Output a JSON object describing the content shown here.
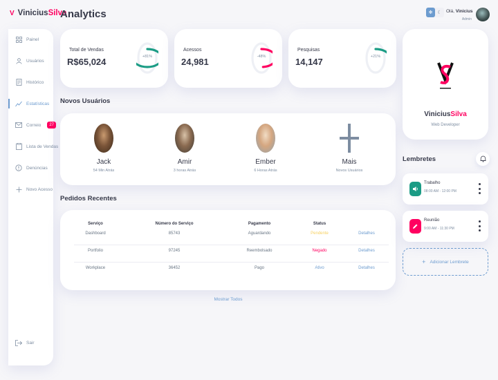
{
  "brand": {
    "first": "Vinicius",
    "second": "Silva"
  },
  "page": {
    "title": "Analytics"
  },
  "sidebar": {
    "items": [
      {
        "label": "Painel",
        "icon": "grid-icon"
      },
      {
        "label": "Usuários",
        "icon": "user-icon"
      },
      {
        "label": "Histórico",
        "icon": "receipt-icon"
      },
      {
        "label": "Estatísticas",
        "icon": "chart-line-icon",
        "active": true
      },
      {
        "label": "Correio",
        "icon": "mail-icon",
        "badge": "27"
      },
      {
        "label": "Lista de Vendas",
        "icon": "inventory-icon"
      },
      {
        "label": "Denúncias",
        "icon": "report-icon"
      },
      {
        "label": "Novo Acesso",
        "icon": "plus-icon"
      }
    ],
    "logout": "Sair"
  },
  "header": {
    "greeting_prefix": "Olá,",
    "user_name": "Vinicius",
    "role": "Admin"
  },
  "stats": [
    {
      "label": "Total de Vendas",
      "value": "R$65,024",
      "percent": "+81%",
      "fraction": 0.81,
      "color": "#1b9c85"
    },
    {
      "label": "Acessos",
      "value": "24,981",
      "percent": "-48%",
      "fraction": 0.48,
      "color": "#ff0060"
    },
    {
      "label": "Pesquisas",
      "value": "14,147",
      "percent": "+21%",
      "fraction": 0.21,
      "color": "#1b9c85"
    }
  ],
  "new_users": {
    "title": "Novos Usuários",
    "users": [
      {
        "name": "Jack",
        "time": "54 Min Atrás"
      },
      {
        "name": "Amir",
        "time": "3 horas Atrás"
      },
      {
        "name": "Ember",
        "time": "6 Horas Atrás"
      },
      {
        "name": "Mais",
        "time": "Novos Usuários"
      }
    ]
  },
  "orders": {
    "title": "Pedidos Recentes",
    "columns": [
      "Serviço",
      "Número do Serviço",
      "Pagamento",
      "Status",
      ""
    ],
    "rows": [
      {
        "service": "Dashboard",
        "number": "85743",
        "payment": "Aguardando",
        "status": "Pendente",
        "status_color": "#f7d060",
        "action": "Detalhes"
      },
      {
        "service": "Portfolio",
        "number": "97245",
        "payment": "Reembolsado",
        "status": "Negado",
        "status_color": "#ff0060",
        "action": "Detalhes"
      },
      {
        "service": "Workplace",
        "number": "36452",
        "payment": "Pago",
        "status": "Ativo",
        "status_color": "#6c9bcf",
        "action": "Detalhes"
      }
    ],
    "show_all": "Mostrar Todos"
  },
  "profile": {
    "name_first": "Vinicius",
    "name_second": "Silva",
    "role": "Web Developer"
  },
  "reminders": {
    "title": "Lembretes",
    "items": [
      {
        "title": "Trabalho",
        "time": "08:00 AM - 12:00 PM",
        "icon": "volume-icon",
        "color": "#1b9c85"
      },
      {
        "title": "Reunião",
        "time": "9:00 AM - 11:30 PM",
        "icon": "edit-icon",
        "color": "#ff0060"
      }
    ],
    "add_label": "Adicionar Lembrete"
  },
  "colors": {
    "primary": "#6c9bcf",
    "danger": "#ff0060",
    "success": "#1b9c85",
    "warning": "#f7d060",
    "dark": "#363949",
    "muted": "#7d8da1"
  }
}
